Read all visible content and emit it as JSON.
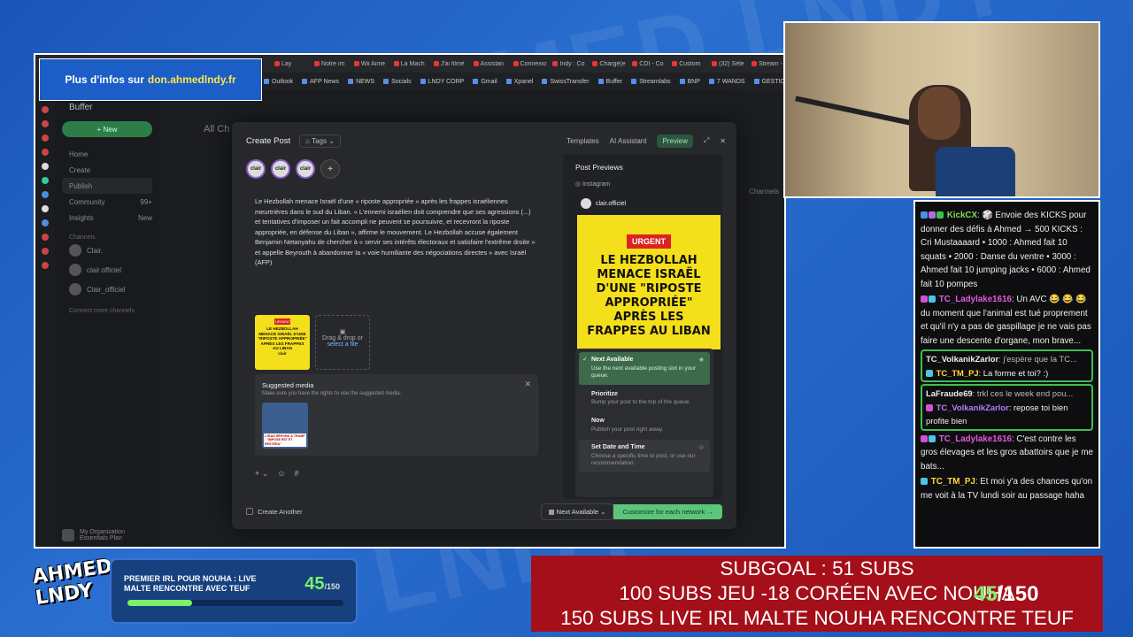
{
  "browser": {
    "tabs": [
      "Lay",
      "Notre im",
      "Wii Aime",
      "La Mach",
      "J'ai filmé",
      "Assistan",
      "Connexio",
      "Indy : Co",
      "Chargé(e",
      "CDI - Co",
      "Custom",
      "(32) Séle",
      "Stream -"
    ],
    "bookmarks": [
      "Outlook",
      "AFP News",
      "NEWS",
      "Socials",
      "LNDY CORP",
      "Gmail",
      "Xpanel",
      "SwissTransfer",
      "Buffer",
      "Streamlabs",
      "BNP",
      "7 WANDS",
      "GESTION STREAM"
    ]
  },
  "sidebar": {
    "logo": "Buffer",
    "new_label": "+ New",
    "items": [
      {
        "label": "Home",
        "count": ""
      },
      {
        "label": "Create",
        "count": ""
      },
      {
        "label": "Publish",
        "count": ""
      },
      {
        "label": "Community",
        "count": "99+"
      },
      {
        "label": "Insights",
        "count": "New"
      }
    ],
    "channels_heading": "Channels",
    "channels": [
      "Clair.",
      "clair.officiel",
      "Clair_officiel"
    ],
    "connect_more": "Connect more channels",
    "org_name": "My Organization",
    "org_plan": "Essentials Plan"
  },
  "main": {
    "header": "All Ch",
    "channels_label": "Channels"
  },
  "modal": {
    "title": "Create Post",
    "tags": "Tags",
    "templates": "Templates",
    "ai_assistant": "AI Assistant",
    "preview": "Preview",
    "post_text": "Le Hezbollah menace Israël d'une « riposte appropriée » après les frappes israéliennes meurtrières dans le sud du Liban. « L'ennemi israélien doit comprendre que ses agressions (...) et tentatives d'imposer un fait accompli ne peuvent se poursuivre, et recevront la riposte appropriée, en défense du Liban », affirme le mouvement. Le Hezbollah accuse également Benjamin Netanyahu de chercher à « servir ses intérêts électoraux et satisfaire l'extrême droite » et appelle Beyrouth à abandonner la « voie humiliante des négociations directes » avec Israël (AFP)",
    "thumb_urgent": "URGENT",
    "thumb_title": "LE HEZBOLLAH MENACE ISRAËL D'UNE \"RIPOSTE APPROPRIÉE\" APRÈS LES FRAPPES AU LIBAN",
    "thumb_brand": "clair",
    "drop_text": "Drag & drop or",
    "drop_link": "select a file",
    "suggested_title": "Suggested media",
    "suggested_sub": "Make sure you have the rights to use the suggested media.",
    "suggested_caption": "L'IRAN RÉPOND À TRUMP : \"IMPOSE EST ET RESTERA\"",
    "create_another": "Create Another",
    "next_available": "Next Available",
    "customize": "Customize for each network →"
  },
  "preview": {
    "heading": "Post Previews",
    "network": "Instagram",
    "account": "clair.officiel",
    "urgent": "URGENT",
    "headline": "LE HEZBOLLAH MENACE ISRAËL D'UNE \"RIPOSTE APPROPRIÉE\" APRÈS LES FRAPPES AU LIBAN",
    "options": [
      {
        "title": "Next Available",
        "desc": "Use the next available posting slot in your queue."
      },
      {
        "title": "Prioritize",
        "desc": "Bump your post to the top of the queue."
      },
      {
        "title": "Now",
        "desc": "Publish your post right away."
      },
      {
        "title": "Set Date and Time",
        "desc": "Choose a specific time to post, or use our recommendation."
      }
    ]
  },
  "info_banner": {
    "text": "Plus d'infos sur",
    "link": "don.ahmedlndy.fr"
  },
  "chat": {
    "m1_user": "KickCX",
    "m1_text": ": 🎲 Envoie des KICKS pour donner des défis à Ahmed → 500 KICKS : Cri Mustaaaard • 1000 : Ahmed fait 10 squats • 2000 : Danse du ventre • 3000 : Ahmed fait 10 jumping jacks • 6000 : Ahmed fait 10 pompes",
    "m2_user": "TC_Ladylake1616",
    "m2_text": ": Un AVC 😂 😂 😂 du moment que l'animal est tué proprement et qu'il n'y a pas de gaspillage je ne vais pas faire une descente d'organe, mon brave...",
    "r1_user": "TC_VolkanikZarlor",
    "r1_text": ": j'espère que la TC...",
    "m3_user": "TC_TM_PJ",
    "m3_text": ": La forme et toi? :)",
    "r2_user": "LaFraude69",
    "r2_text": ": trkl ces le week end pou...",
    "m4_user": "TC_VolkanikZarlor",
    "m4_text": ": repose toi bien profite bien",
    "m5_user": "TC_Ladylake1616",
    "m5_text": ": C'est contre les gros élevages et les gros abattoirs que je me bats...",
    "m6_user": "TC_TM_PJ",
    "m6_text": ": Et moi y'a des chances qu'on me voit à la TV lundi soir au passage haha"
  },
  "irl_goal": {
    "title": "PREMIER IRL POUR NOUHA : LIVE MALTE RENCONTRE AVEC TEUF",
    "current": "45",
    "total": "/150",
    "progress": 0.3
  },
  "logo": {
    "line1": "AHMED",
    "line2": "LNDY"
  },
  "subgoal": {
    "line1": "SUBGOAL : 51 SUBS",
    "line2": "100 SUBS JEU -18 CORÉEN AVEC NOUHA",
    "line3": "150 SUBS LIVE IRL MALTE NOUHA RENCONTRE TEUF",
    "overlay_current": "45",
    "overlay_total": "/150"
  },
  "colors": {
    "accent_green": "#7cf06b",
    "goal_red": "#a40f1a",
    "brand_blue": "#1c5ec7"
  }
}
